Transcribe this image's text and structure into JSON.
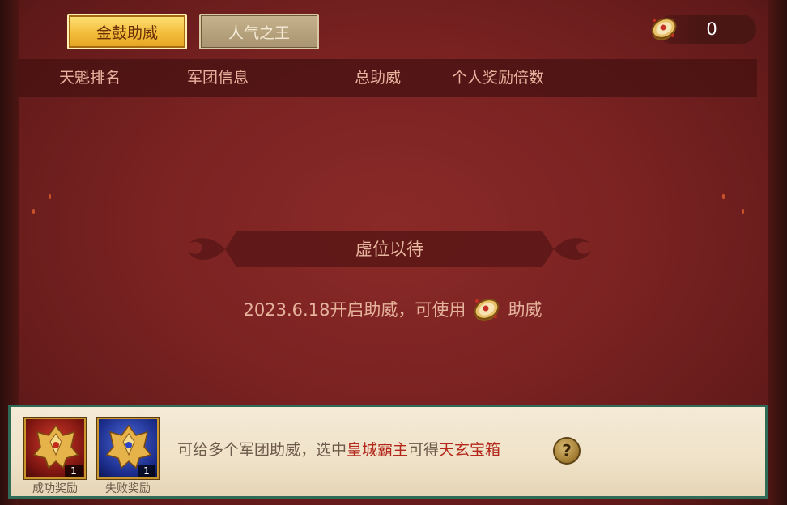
{
  "tabs": {
    "active_label": "金鼓助威",
    "inactive_label": "人气之王"
  },
  "currency": {
    "icon": "drum-icon",
    "value": "0"
  },
  "table": {
    "columns": [
      "天魁排名",
      "军团信息",
      "总助威",
      "个人奖励倍数"
    ]
  },
  "empty_state": {
    "title": "虚位以待",
    "message_before": "2023.6.18开启助威，可使用",
    "icon": "drum-icon",
    "message_after": "助威"
  },
  "bottom_panel": {
    "rewards": [
      {
        "label": "成功奖励",
        "count": "1",
        "icon": "red-helmet-icon"
      },
      {
        "label": "失败奖励",
        "count": "1",
        "icon": "blue-helmet-icon"
      }
    ],
    "info_part1": "可给多个军团助威，选中",
    "info_highlight1": "皇城霸主",
    "info_part2": "可得",
    "info_highlight2": "天玄宝箱",
    "help_label": "?"
  },
  "colors": {
    "background": "#7a2222",
    "tab_active": "#f2bd3a",
    "tab_inactive": "#a99370",
    "highlight_text": "#b4281c",
    "panel_border": "#2f6b57"
  }
}
